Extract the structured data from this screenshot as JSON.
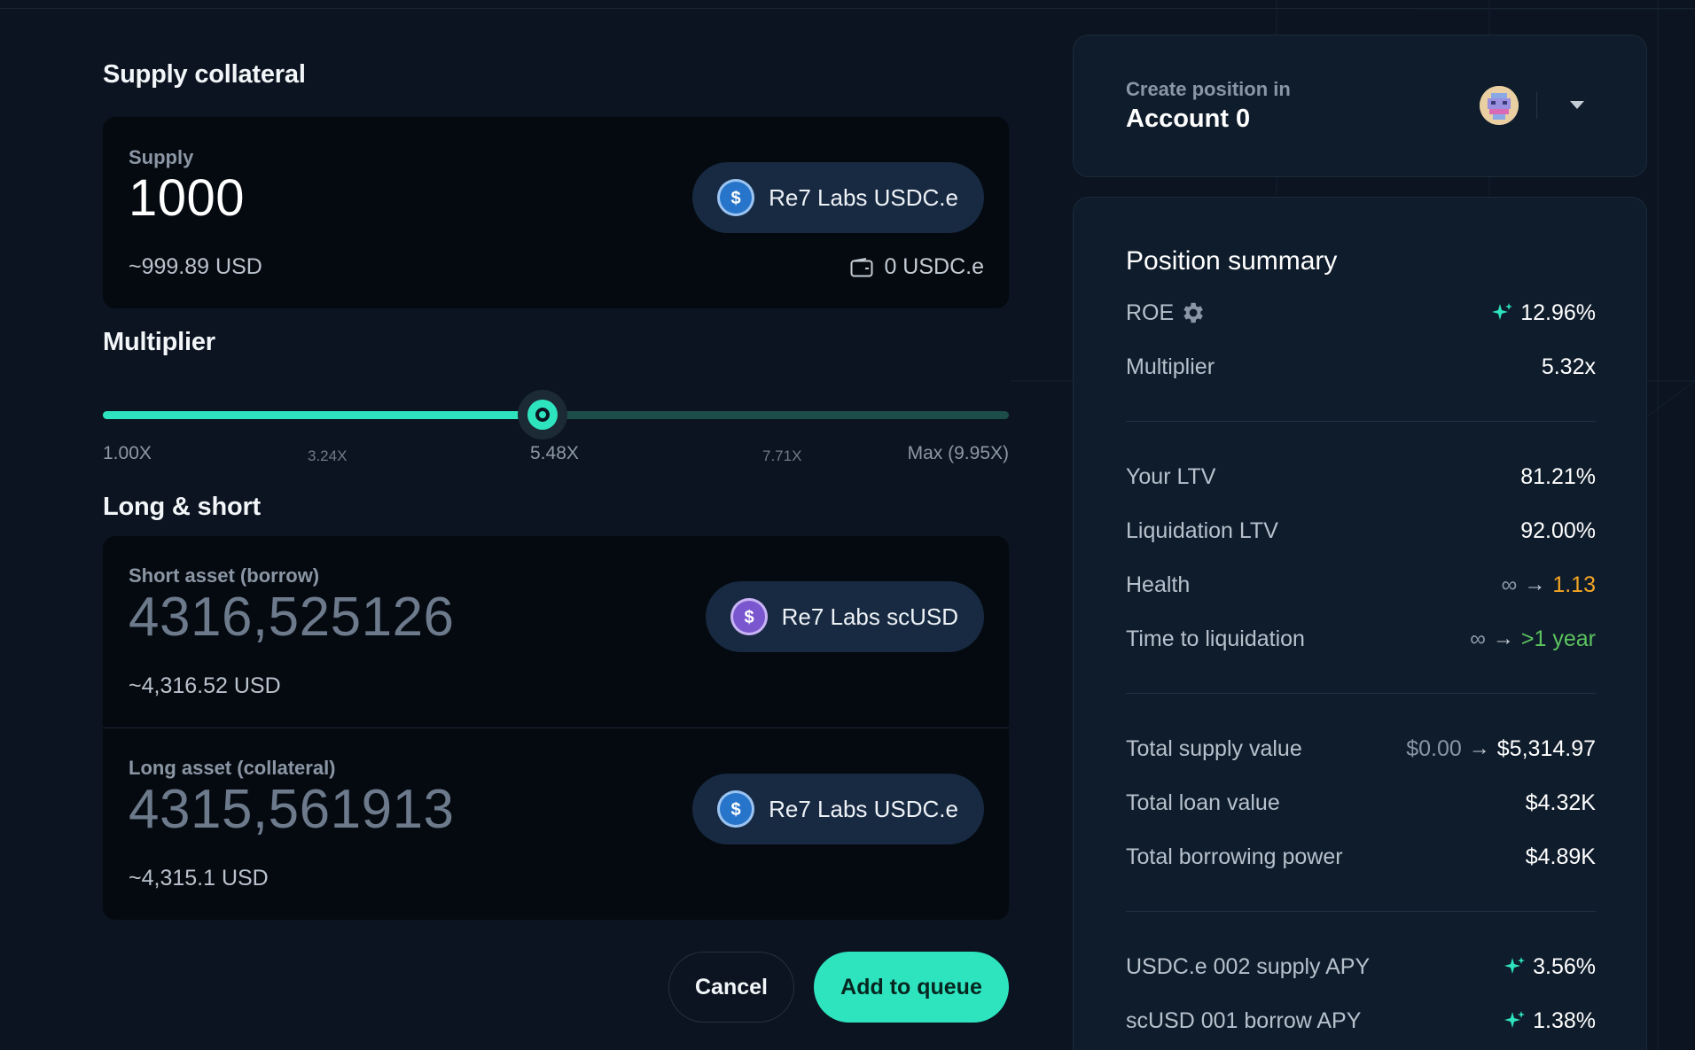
{
  "colors": {
    "background": "#0b1420",
    "accent": "#2ee4bf",
    "card": "#050a10",
    "panel": "#0f1c2b",
    "health_warning": "#f5a524",
    "positive": "#5cc35f"
  },
  "supply_section": {
    "title": "Supply collateral",
    "label": "Supply",
    "amount": "1000",
    "usd": "~999.89 USD",
    "token": "Re7 Labs USDC.e",
    "token_icon": "usdc-coin-icon",
    "balance": "0 USDC.e",
    "balance_icon": "wallet-icon"
  },
  "multiplier_section": {
    "title": "Multiplier",
    "value_fraction": 0.4857,
    "ticks": {
      "t1": "1.00X",
      "t2": "3.24X",
      "t3": "5.48X",
      "t4": "7.71X",
      "t5": "Max (9.95X)"
    }
  },
  "long_short_section": {
    "title": "Long & short",
    "short": {
      "label": "Short asset (borrow)",
      "amount": "4316,525126",
      "usd": "~4,316.52 USD",
      "token": "Re7 Labs scUSD",
      "token_icon": "scusd-coin-icon"
    },
    "long": {
      "label": "Long asset (collateral)",
      "amount": "4315,561913",
      "usd": "~4,315.1 USD",
      "token": "Re7 Labs USDC.e",
      "token_icon": "usdc-coin-icon"
    }
  },
  "actions": {
    "cancel": "Cancel",
    "submit": "Add to queue"
  },
  "account": {
    "label": "Create position in",
    "name": "Account 0"
  },
  "summary": {
    "title": "Position summary",
    "roe_label": "ROE",
    "roe_value": "12.96%",
    "multiplier_label": "Multiplier",
    "multiplier_value": "5.32x",
    "ltv_label": "Your LTV",
    "ltv_value": "81.21%",
    "liq_ltv_label": "Liquidation LTV",
    "liq_ltv_value": "92.00%",
    "health_label": "Health",
    "health_from": "∞",
    "health_to": "1.13",
    "ttl_label": "Time to liquidation",
    "ttl_from": "∞",
    "ttl_to": ">1 year",
    "supply_value_label": "Total supply value",
    "supply_value_from": "$0.00",
    "supply_value_to": "$5,314.97",
    "loan_value_label": "Total loan value",
    "loan_value": "$4.32K",
    "borrow_power_label": "Total borrowing power",
    "borrow_power_value": "$4.89K",
    "supply_apy_label": "USDC.e 002 supply APY",
    "supply_apy_value": "3.56%",
    "borrow_apy_label": "scUSD 001 borrow APY",
    "borrow_apy_value": "1.38%"
  }
}
